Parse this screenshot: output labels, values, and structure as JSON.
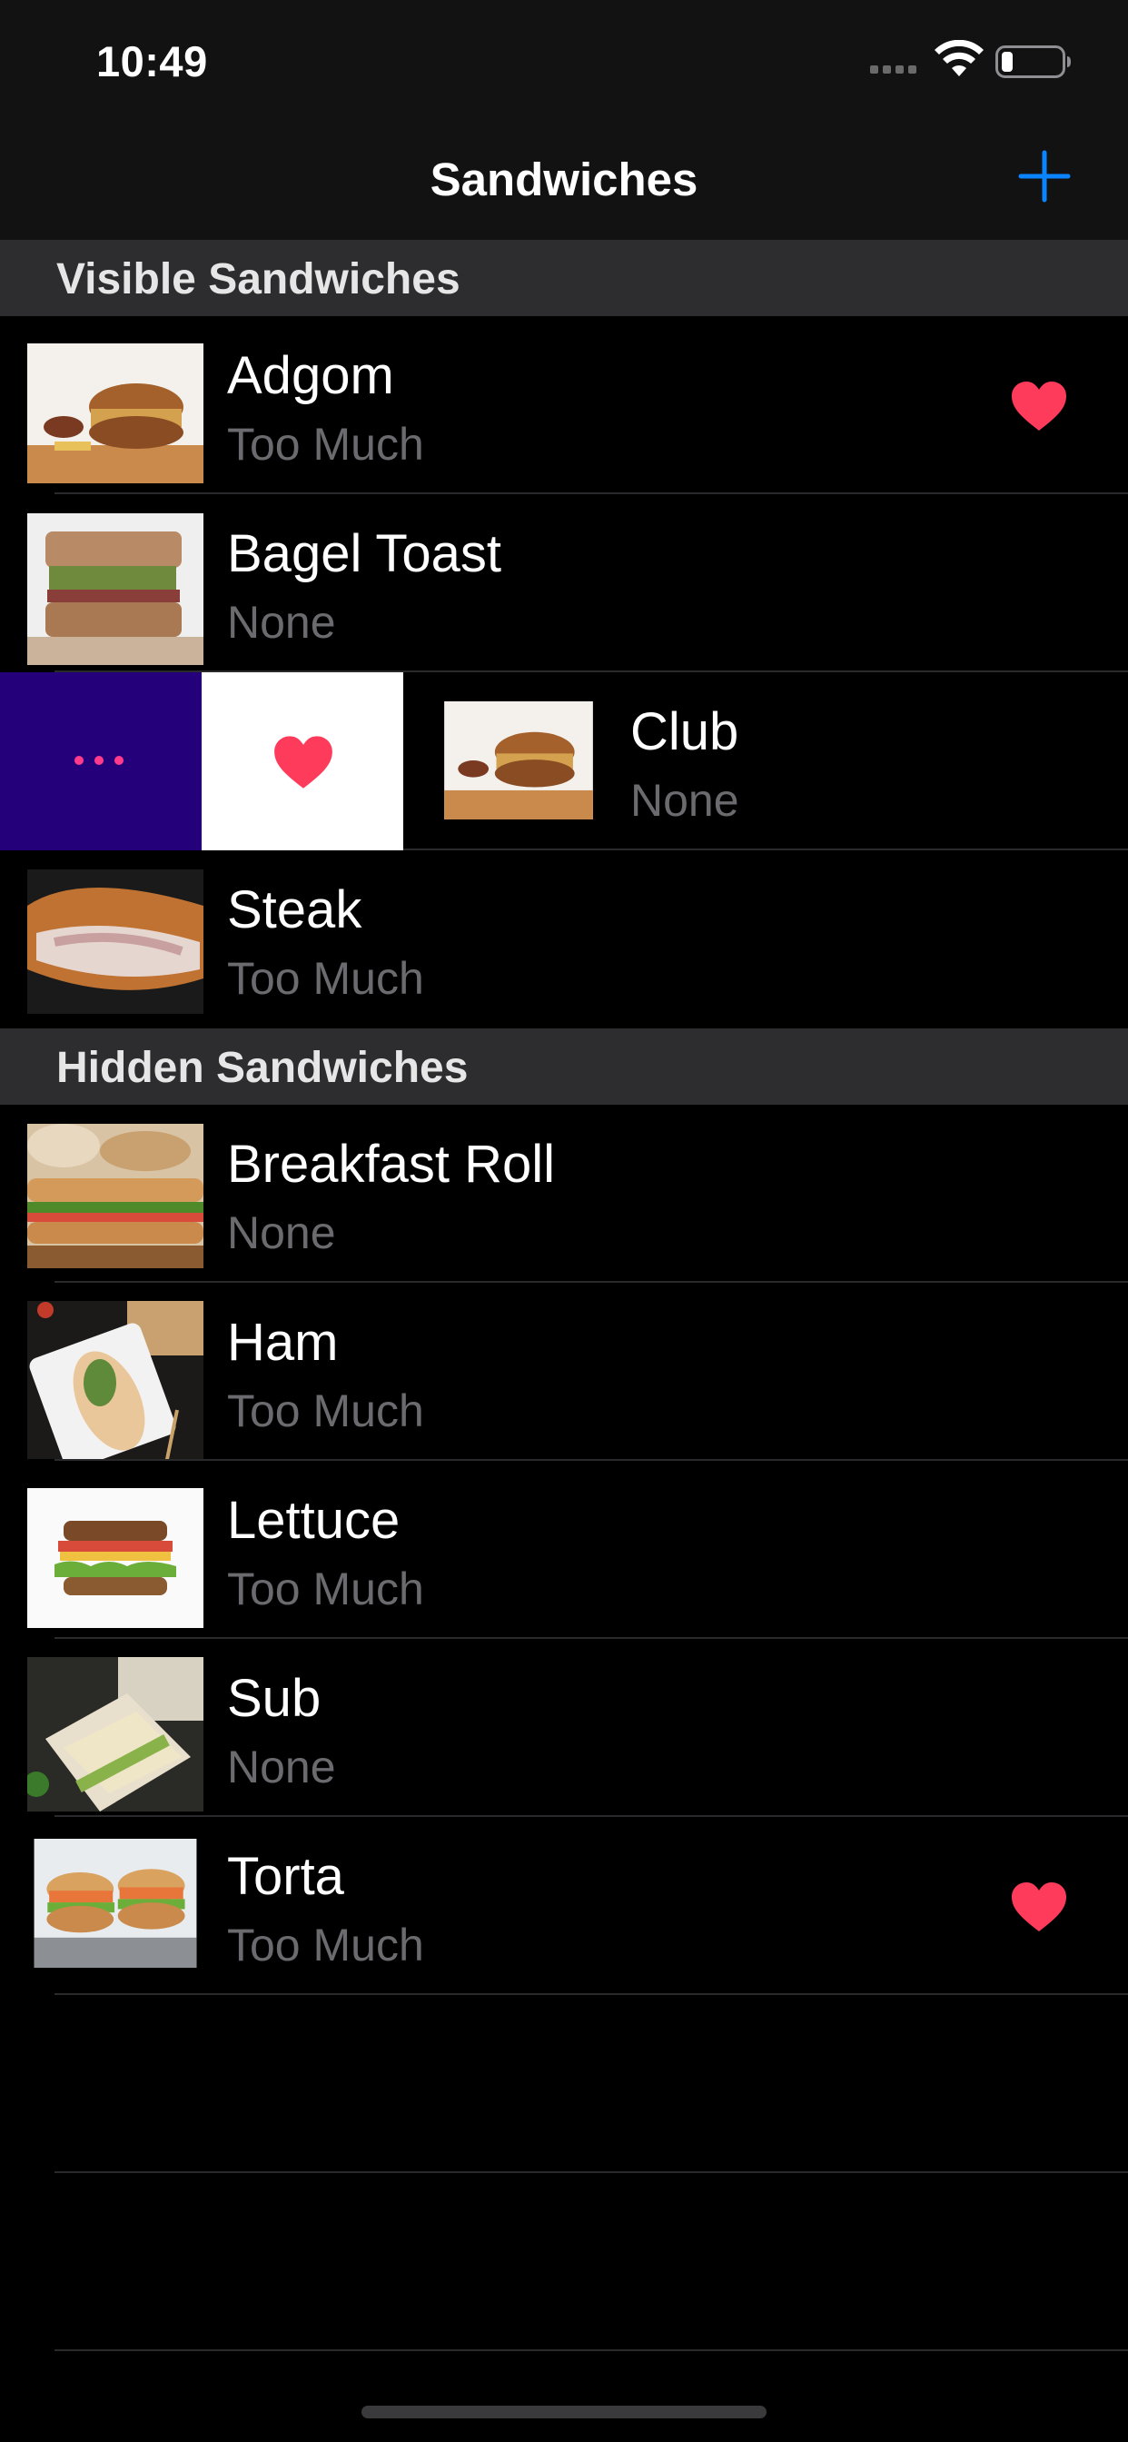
{
  "status_bar": {
    "time": "10:49"
  },
  "nav": {
    "title": "Sandwiches",
    "add_icon": "plus-icon",
    "accent_color": "#0a84ff"
  },
  "sections": [
    {
      "title": "Visible Sandwiches",
      "rows": [
        {
          "name": "Adgom",
          "subtitle": "Too Much",
          "favorite": true
        },
        {
          "name": "Bagel Toast",
          "subtitle": "None",
          "favorite": false
        },
        {
          "name": "Club",
          "subtitle": "None",
          "favorite": false,
          "swiped": true
        },
        {
          "name": "Steak",
          "subtitle": "Too Much",
          "favorite": false
        }
      ]
    },
    {
      "title": "Hidden Sandwiches",
      "rows": [
        {
          "name": "Breakfast Roll",
          "subtitle": "None",
          "favorite": false
        },
        {
          "name": "Ham",
          "subtitle": "Too Much",
          "favorite": false
        },
        {
          "name": "Lettuce",
          "subtitle": "Too Much",
          "favorite": false
        },
        {
          "name": "Sub",
          "subtitle": "None",
          "favorite": false
        },
        {
          "name": "Torta",
          "subtitle": "Too Much",
          "favorite": true
        }
      ]
    }
  ],
  "swipe_actions": {
    "more_icon": "ellipsis-icon",
    "favorite_icon": "heart-icon",
    "more_color": "#24007a",
    "heart_color": "#ff3b5c"
  }
}
